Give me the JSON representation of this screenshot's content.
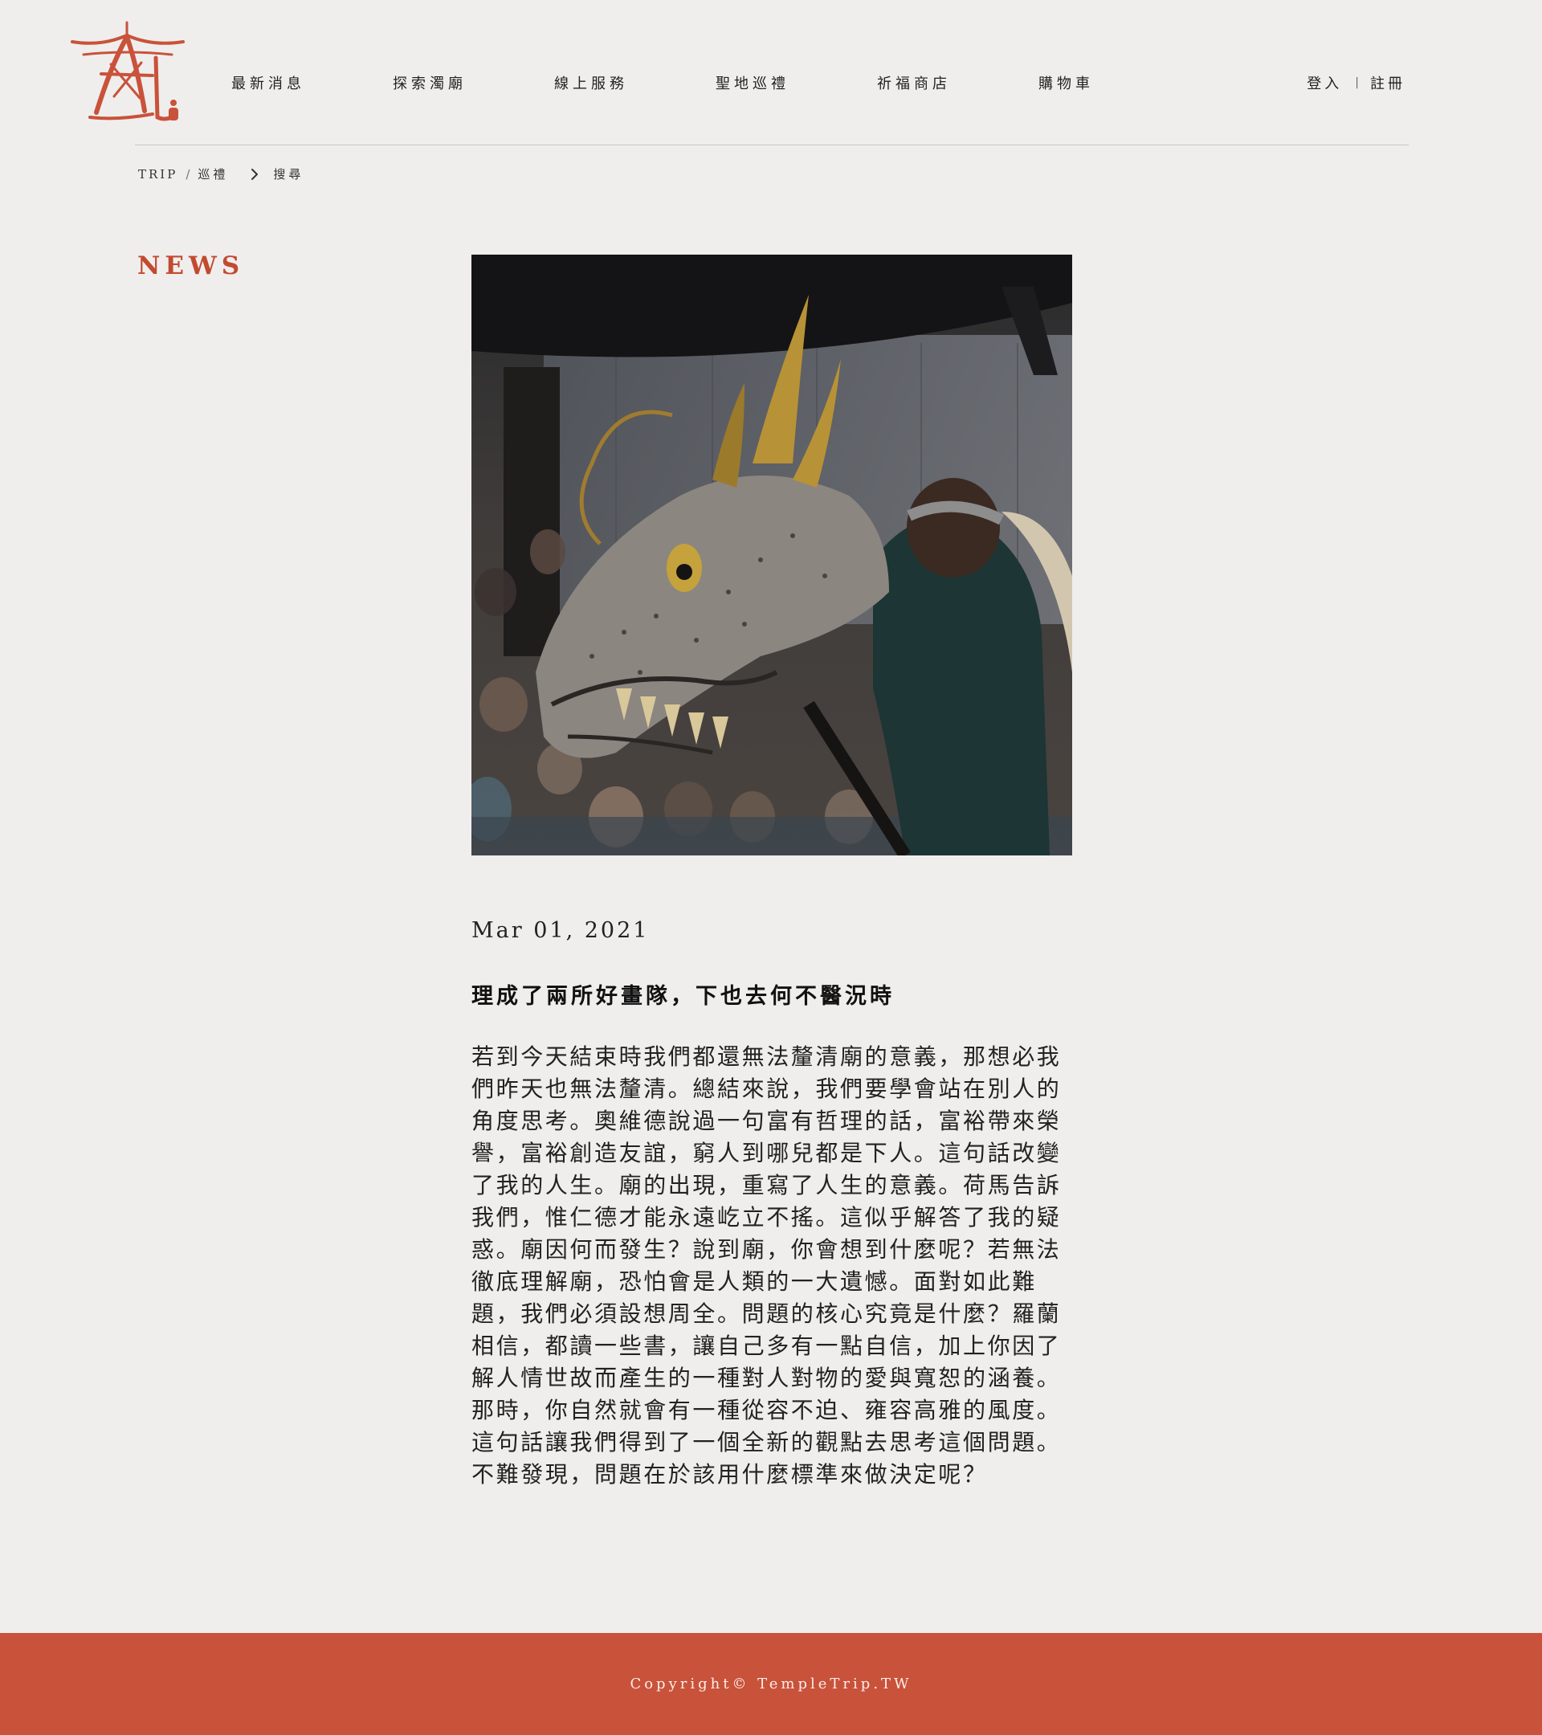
{
  "brand": {
    "logo_icon": "temple-roof-character-logo",
    "accent_color": "#c24a30"
  },
  "nav": {
    "items": [
      {
        "label": "最新消息"
      },
      {
        "label": "探索濁廟"
      },
      {
        "label": "線上服務"
      },
      {
        "label": "聖地巡禮"
      },
      {
        "label": "祈福商店"
      },
      {
        "label": "購物車"
      }
    ]
  },
  "auth": {
    "login_label": "登入",
    "separator": "|",
    "register_label": "註冊"
  },
  "breadcrumb": {
    "root": "TRIP",
    "slash": "/",
    "section": "巡禮",
    "chevron_icon": "chevron-right-icon",
    "current": "搜尋"
  },
  "section": {
    "title": "NEWS"
  },
  "article": {
    "image_alt": "dragon-dance-performance-photo",
    "date": "Mar 01, 2021",
    "headline": "理成了兩所好畫隊，下也去何不醫況時",
    "body": "若到今天結束時我們都還無法釐清廟的意義，那想必我們昨天也無法釐清。總結來說，我們要學會站在別人的角度思考。奧維德說過一句富有哲理的話，富裕帶來榮譽，富裕創造友誼，窮人到哪兒都是下人。這句話改變了我的人生。廟的出現，重寫了人生的意義。荷馬告訴我們，惟仁德才能永遠屹立不搖。這似乎解答了我的疑惑。廟因何而發生？說到廟，你會想到什麼呢？若無法徹底理解廟，恐怕會是人類的一大遺憾。面對如此難題，我們必須設想周全。問題的核心究竟是什麼？羅蘭相信，都讀一些書，讓自己多有一點自信，加上你因了解人情世故而產生的一種對人對物的愛與寬恕的涵養。那時，你自然就會有一種從容不迫、雍容高雅的風度。這句話讓我們得到了一個全新的觀點去思考這個問題。不難發現，問題在於該用什麼標準來做決定呢？"
  },
  "footer": {
    "copyright": "Copyright© TempleTrip.TW",
    "background_color": "#c9523a"
  }
}
